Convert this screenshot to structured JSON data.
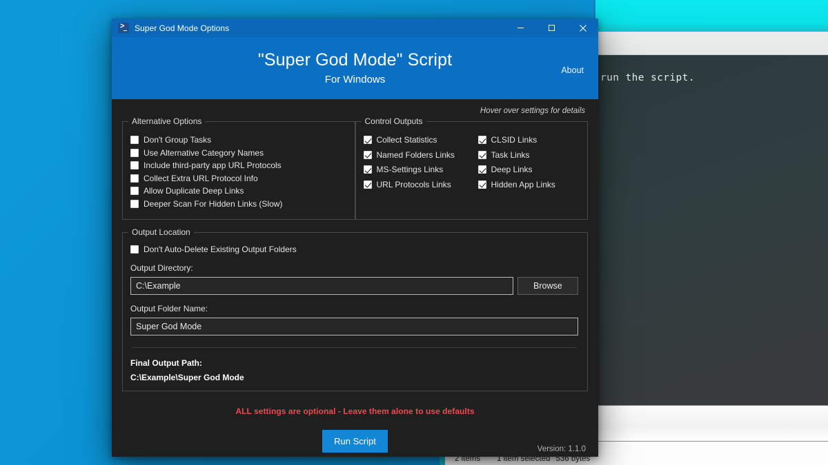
{
  "desktop": {
    "background_color": "#0b93d5"
  },
  "background_window": {
    "accent_color": "#09e2e8",
    "console_text": "run the script.",
    "statusbar": {
      "items_count": "2 items",
      "selection": "1 item selected",
      "size": "536 bytes"
    }
  },
  "dialog": {
    "titlebar": {
      "icon": "powershell-icon",
      "title": "Super God Mode Options",
      "minimize_label": "–",
      "maximize_label": "□",
      "close_label": "✕"
    },
    "header": {
      "title": "\"Super God Mode\" Script",
      "subtitle": "For Windows",
      "about_label": "About",
      "band_color": "#0b6fc4"
    },
    "hover_hint": "Hover over settings for details",
    "alternative_options": {
      "title": "Alternative Options",
      "items": [
        {
          "label": "Don't Group Tasks",
          "checked": false
        },
        {
          "label": "Use Alternative Category Names",
          "checked": false
        },
        {
          "label": "Include third-party app URL Protocols",
          "checked": false
        },
        {
          "label": "Collect Extra URL Protocol Info",
          "checked": false
        },
        {
          "label": "Allow Duplicate Deep Links",
          "checked": false
        },
        {
          "label": "Deeper Scan For Hidden Links (Slow)",
          "checked": false
        }
      ]
    },
    "control_outputs": {
      "title": "Control Outputs",
      "column_left": [
        {
          "label": "Collect Statistics",
          "checked": true
        },
        {
          "label": "Named Folders Links",
          "checked": true
        },
        {
          "label": "MS-Settings Links",
          "checked": true
        },
        {
          "label": "URL Protocols Links",
          "checked": true
        }
      ],
      "column_right": [
        {
          "label": "CLSID Links",
          "checked": true
        },
        {
          "label": "Task Links",
          "checked": true
        },
        {
          "label": "Deep Links",
          "checked": true
        },
        {
          "label": "Hidden App Links",
          "checked": true
        }
      ]
    },
    "output_location": {
      "title": "Output Location",
      "no_autodelete": {
        "label": "Don't Auto-Delete Existing Output Folders",
        "checked": false
      },
      "directory_label": "Output Directory:",
      "directory_value": "C:\\Example",
      "directory_placeholder": "C:\\Example",
      "browse_label": "Browse",
      "folder_label": "Output Folder Name:",
      "folder_value": "Super God Mode",
      "folder_placeholder": "Super God Mode",
      "final_path_label": "Final Output Path:",
      "final_path_value": "C:\\Example\\Super God Mode"
    },
    "footer": {
      "optional_note": "ALL settings are optional - Leave them alone to use defaults",
      "note_color": "#f0484f",
      "run_label": "Run Script",
      "run_color": "#1386d6",
      "version": "Version: 1.1.0"
    }
  }
}
